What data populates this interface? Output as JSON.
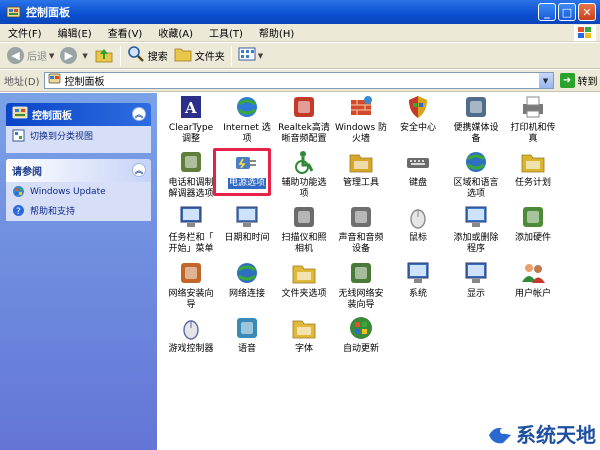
{
  "window": {
    "title": "控制面板",
    "min": "_",
    "max": "□",
    "close": "✕"
  },
  "menu": [
    "文件(F)",
    "编辑(E)",
    "查看(V)",
    "收藏(A)",
    "工具(T)",
    "帮助(H)"
  ],
  "toolbar": {
    "back": "后退",
    "search": "搜索",
    "folders": "文件夹"
  },
  "address": {
    "label": "地址(D)",
    "value": "控制面板",
    "go": "转到"
  },
  "sidebar": {
    "panel1": {
      "title": "控制面板",
      "items": [
        {
          "label": "切换到分类视图",
          "icon": "switch-icon"
        }
      ]
    },
    "panel2": {
      "title": "请参阅",
      "items": [
        {
          "label": "Windows Update",
          "icon": "windows-update-icon"
        },
        {
          "label": "帮助和支持",
          "icon": "help-icon"
        }
      ]
    }
  },
  "icons": [
    {
      "label": "ClearType\n调整",
      "icon": "cleartype-icon",
      "color": "#2b2f8a"
    },
    {
      "label": "Internet 选\n项",
      "icon": "internet-options-icon",
      "color": "#2d7bd6"
    },
    {
      "label": "Realtek高清\n晰音频配置",
      "icon": "realtek-audio-icon",
      "color": "#c23a2a"
    },
    {
      "label": "Windows 防\n火墙",
      "icon": "firewall-icon",
      "color": "#d24a2a"
    },
    {
      "label": "安全中心",
      "icon": "security-center-icon",
      "color": "#d9a21b"
    },
    {
      "label": "便携媒体设\n备",
      "icon": "portable-media-icon",
      "color": "#4f6d8a"
    },
    {
      "label": "打印机和传\n真",
      "icon": "printer-icon",
      "color": "#7a7a7a"
    },
    {
      "label": "电话和调制\n解调器选项",
      "icon": "phone-modem-icon",
      "color": "#5f7f3a"
    },
    {
      "label": "电源选项",
      "icon": "power-options-icon",
      "color": "#4a7fc4",
      "selected": true
    },
    {
      "label": "辅助功能选\n项",
      "icon": "accessibility-icon",
      "color": "#2f8a3a"
    },
    {
      "label": "管理工具",
      "icon": "admin-tools-icon",
      "color": "#d6a72b"
    },
    {
      "label": "键盘",
      "icon": "keyboard-icon",
      "color": "#6b6b6b"
    },
    {
      "label": "区域和语言\n选项",
      "icon": "region-language-icon",
      "color": "#2f6fbf"
    },
    {
      "label": "任务计划",
      "icon": "scheduled-tasks-icon",
      "color": "#d8b42f"
    },
    {
      "label": "任务栏和「\n开始」菜单",
      "icon": "taskbar-start-icon",
      "color": "#3a66b8"
    },
    {
      "label": "日期和时间",
      "icon": "date-time-icon",
      "color": "#4f7fbf"
    },
    {
      "label": "扫描仪和照\n相机",
      "icon": "scanner-camera-icon",
      "color": "#6b6b6b"
    },
    {
      "label": "声音和音频\n设备",
      "icon": "sound-icon",
      "color": "#707070"
    },
    {
      "label": "鼠标",
      "icon": "mouse-icon",
      "color": "#8a8a8a"
    },
    {
      "label": "添加或删除\n程序",
      "icon": "add-remove-programs-icon",
      "color": "#3a7ad0"
    },
    {
      "label": "添加硬件",
      "icon": "add-hardware-icon",
      "color": "#4d8a3a"
    },
    {
      "label": "网络安装向\n导",
      "icon": "network-setup-icon",
      "color": "#c2662a"
    },
    {
      "label": "网络连接",
      "icon": "network-connections-icon",
      "color": "#2f6fbf"
    },
    {
      "label": "文件夹选项",
      "icon": "folder-options-icon",
      "color": "#e0b83a"
    },
    {
      "label": "无线网络安\n装向导",
      "icon": "wireless-setup-icon",
      "color": "#4a7a3a"
    },
    {
      "label": "系统",
      "icon": "system-icon",
      "color": "#3a6fbf"
    },
    {
      "label": "显示",
      "icon": "display-icon",
      "color": "#3a6fbf"
    },
    {
      "label": "用户帐户",
      "icon": "user-accounts-icon",
      "color": "#2f8a3a"
    },
    {
      "label": "游戏控制器",
      "icon": "game-controller-icon",
      "color": "#5a6aa8"
    },
    {
      "label": "语音",
      "icon": "speech-icon",
      "color": "#3a8ab8"
    },
    {
      "label": "字体",
      "icon": "fonts-icon",
      "color": "#e0b83a"
    },
    {
      "label": "自动更新",
      "icon": "automatic-updates-icon",
      "color": "#3a8a3a"
    }
  ],
  "watermark": {
    "text": "系统天地"
  }
}
